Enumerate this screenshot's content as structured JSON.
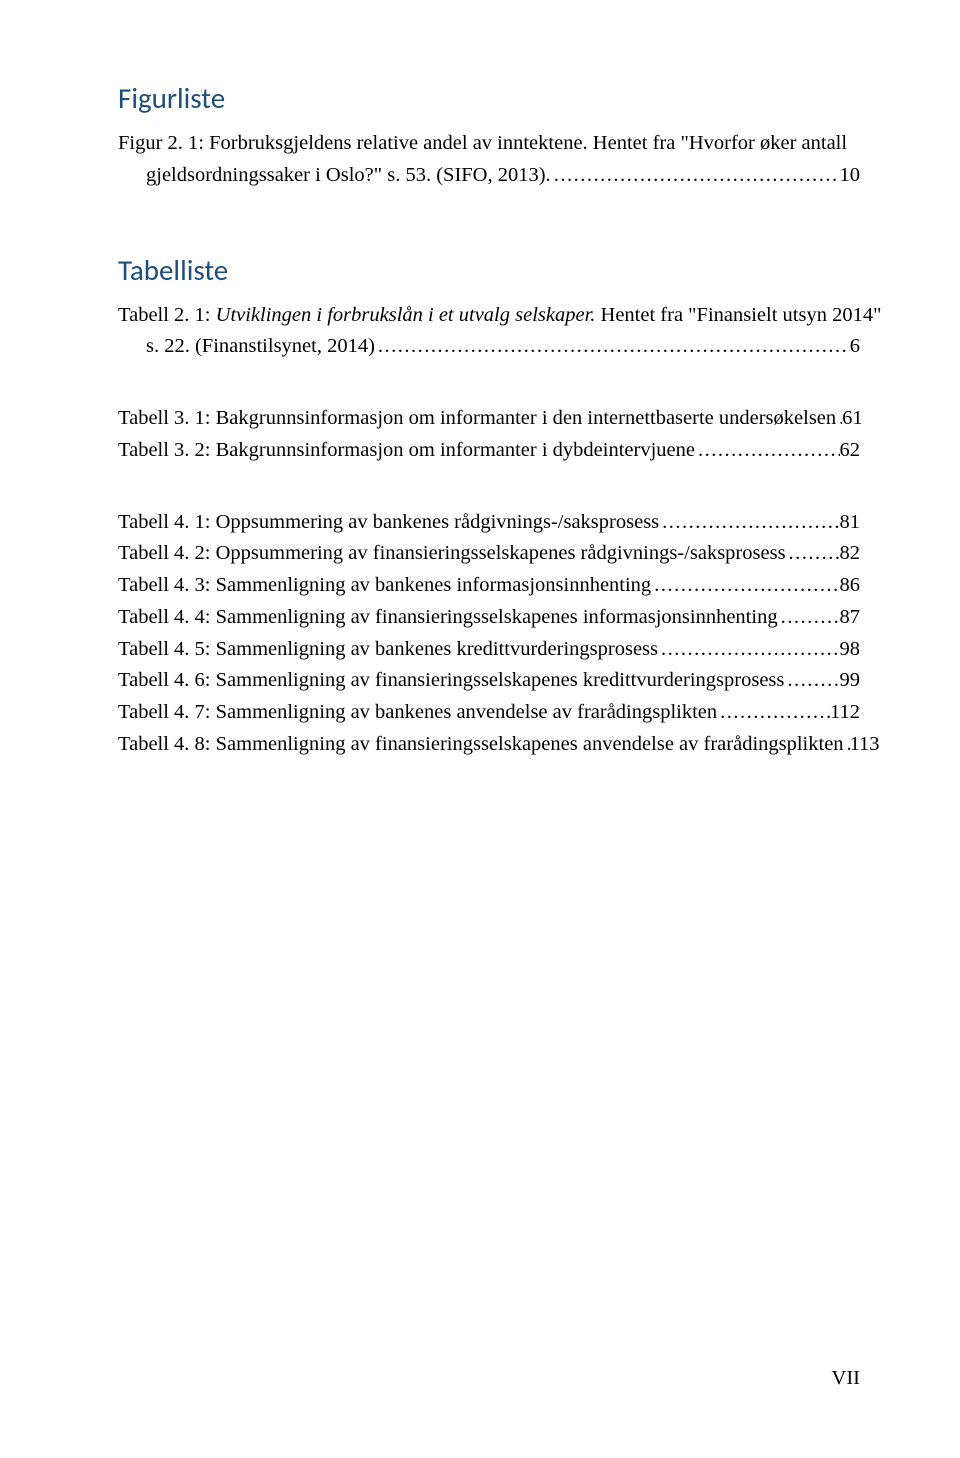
{
  "figurliste": {
    "heading": "Figurliste",
    "entries": [
      {
        "line1": "Figur 2. 1: Forbruksgjeldens relative andel av inntektene. Hentet fra \"Hvorfor øker antall",
        "line2_text": "gjeldsordningssaker i Oslo?\" s. 53. (SIFO, 2013).",
        "page": "10"
      }
    ]
  },
  "tabelliste": {
    "heading": "Tabelliste",
    "group1": [
      {
        "line1_prefix": "Tabell 2. 1: ",
        "line1_italic": "Utviklingen i forbrukslån i et utvalg selskaper.",
        "line1_suffix": " Hentet fra \"Finansielt utsyn 2014\"",
        "line2_text": "s. 22. (Finanstilsynet, 2014)",
        "page": "6"
      }
    ],
    "group2": [
      {
        "text": "Tabell 3. 1: Bakgrunnsinformasjon om informanter i den internettbaserte undersøkelsen",
        "page": "61"
      },
      {
        "text": "Tabell 3. 2: Bakgrunnsinformasjon om informanter i dybdeintervjuene",
        "page": "62"
      }
    ],
    "group3": [
      {
        "text": "Tabell 4. 1: Oppsummering av bankenes rådgivnings-/saksprosess",
        "page": "81"
      },
      {
        "text": "Tabell 4. 2: Oppsummering av finansieringsselskapenes rådgivnings-/saksprosess",
        "page": "82"
      },
      {
        "text": "Tabell 4. 3: Sammenligning av bankenes informasjonsinnhenting",
        "page": "86"
      },
      {
        "text": "Tabell 4. 4: Sammenligning av finansieringsselskapenes informasjonsinnhenting",
        "page": "87"
      },
      {
        "text": "Tabell 4. 5: Sammenligning av bankenes kredittvurderingsprosess",
        "page": "98"
      },
      {
        "text": "Tabell 4. 6: Sammenligning av finansieringsselskapenes kredittvurderingsprosess",
        "page": "99"
      },
      {
        "text": "Tabell 4. 7: Sammenligning av bankenes anvendelse av frarådingsplikten",
        "page": "112"
      },
      {
        "text": "Tabell 4. 8: Sammenligning av finansieringsselskapenes anvendelse av frarådingsplikten",
        "page": "113"
      }
    ]
  },
  "pageNumber": "VII"
}
